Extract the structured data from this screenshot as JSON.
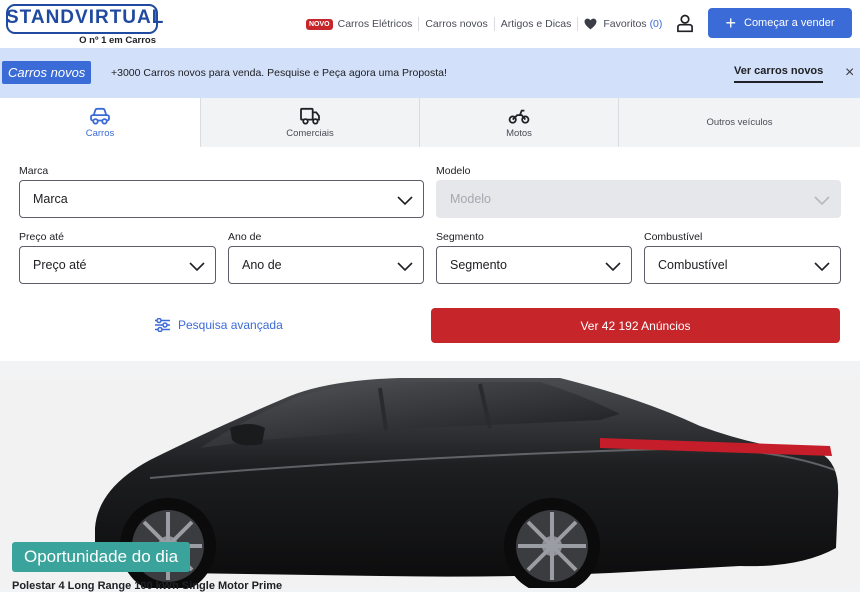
{
  "header": {
    "logo_text": "STANDVIRTUAL",
    "logo_tagline": "O nº 1 em Carros",
    "novo_badge": "NOVO",
    "nav": [
      "Carros Elétricos",
      "Carros novos",
      "Artigos e Dicas"
    ],
    "favorites_label": "Favoritos",
    "favorites_count": "(0)",
    "sell_button": "Começar a vender"
  },
  "banner": {
    "badge": "Carros novos",
    "text": "+3000 Carros novos para venda. Pesquise e Peça agora uma Proposta!",
    "link": "Ver carros novos",
    "close_icon": "×"
  },
  "tabs": [
    {
      "label": "Carros",
      "icon": "car-icon",
      "active": true
    },
    {
      "label": "Comerciais",
      "icon": "truck-icon",
      "active": false
    },
    {
      "label": "Motos",
      "icon": "motorcycle-icon",
      "active": false
    },
    {
      "label": "Outros veículos",
      "icon": "",
      "active": false
    }
  ],
  "form": {
    "marca": {
      "label": "Marca",
      "value": "Marca"
    },
    "modelo": {
      "label": "Modelo",
      "value": "Modelo"
    },
    "preco": {
      "label": "Preço até",
      "value": "Preço até"
    },
    "ano": {
      "label": "Ano de",
      "value": "Ano de"
    },
    "segmento": {
      "label": "Segmento",
      "value": "Segmento"
    },
    "combustivel": {
      "label": "Combustível",
      "value": "Combustível"
    },
    "advanced_search": "Pesquisa avançada",
    "submit": "Ver 42 192 Anúncios"
  },
  "hero": {
    "badge": "Oportunidade do dia",
    "car_title": "Polestar 4 Long Range 100 kWh Single Motor Prime"
  },
  "colors": {
    "brand_blue": "#3b6bd6",
    "logo_blue": "#1f4aa0",
    "cta_red": "#c6262a",
    "badge_teal": "#3aa39c",
    "banner_bg": "#d2e0f9"
  }
}
